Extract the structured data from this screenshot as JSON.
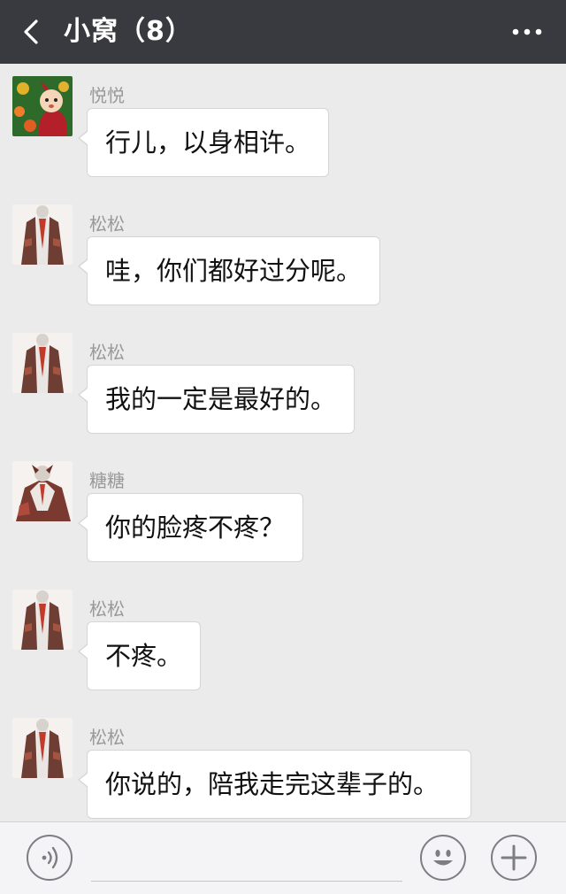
{
  "header": {
    "title": "小窝（8）",
    "back_icon": "chevron-left-icon",
    "more_icon": "more-horizontal-icon"
  },
  "messages": [
    {
      "sender": "悦悦",
      "text": "行儿，以身相许。"
    },
    {
      "sender": "松松",
      "text": "哇，你们都好过分呢。"
    },
    {
      "sender": "松松",
      "text": "我的一定是最好的。"
    },
    {
      "sender": "糖糖",
      "text": "你的脸疼不疼？"
    },
    {
      "sender": "松松",
      "text": "不疼。"
    },
    {
      "sender": "松松",
      "text": "你说的，陪我走完这辈子的。"
    }
  ],
  "input_bar": {
    "voice_icon": "voice-icon",
    "emoji_icon": "emoji-icon",
    "plus_icon": "plus-icon",
    "input_value": ""
  },
  "colors": {
    "header_bg": "#393a3f",
    "chat_bg": "#ebebeb",
    "bubble_bg": "#ffffff",
    "input_bar_bg": "#f4f4f6"
  }
}
